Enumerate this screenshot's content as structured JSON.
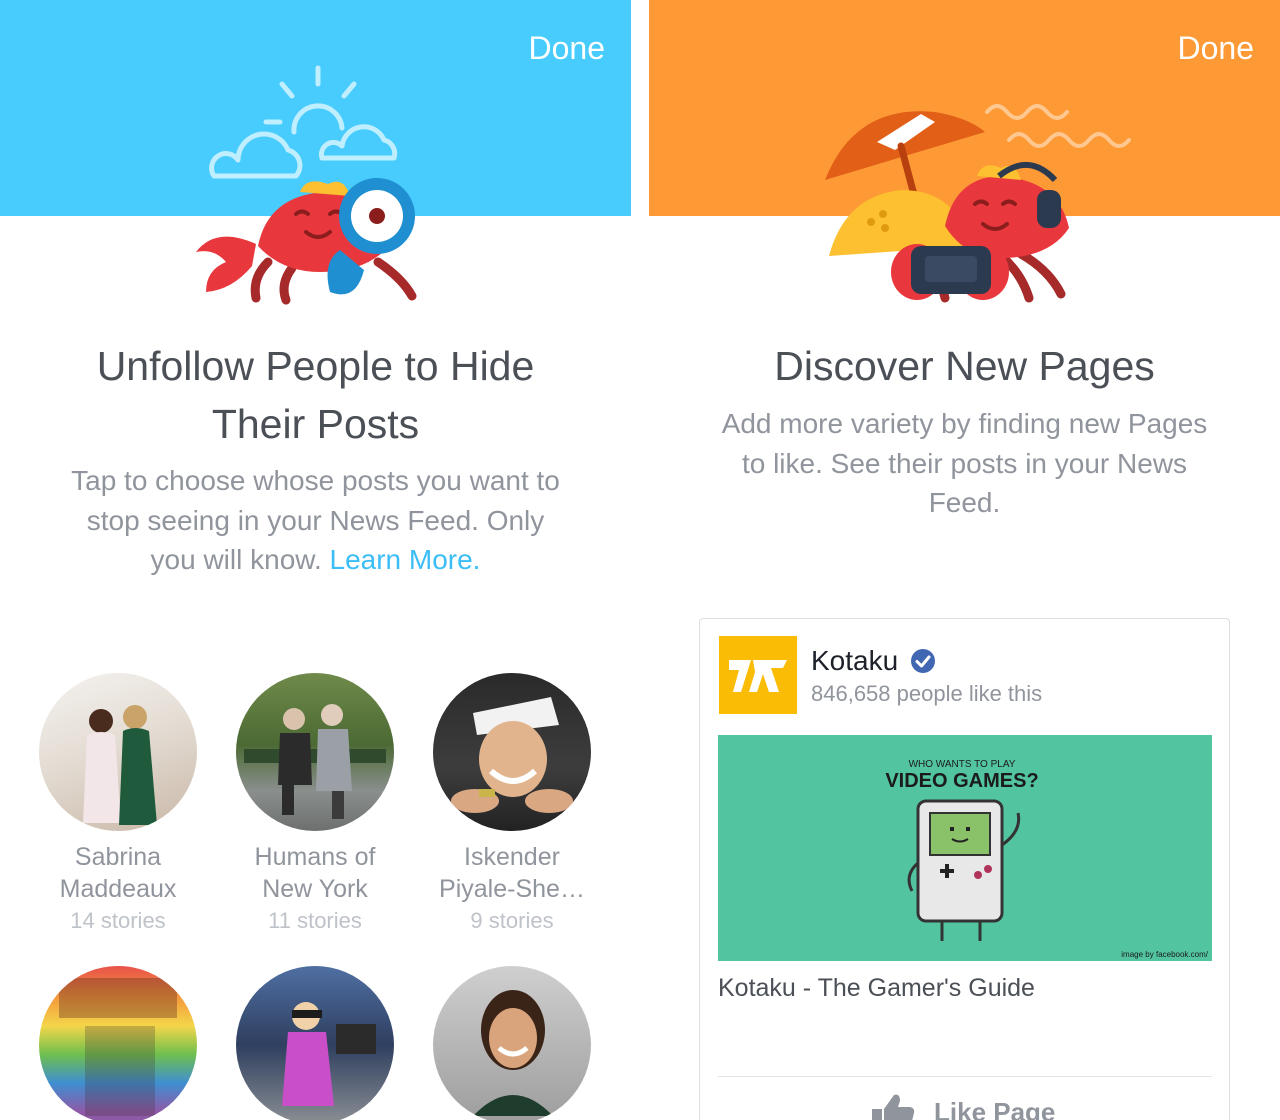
{
  "left_panel": {
    "banner_color": "#47ccfd",
    "done_label": "Done",
    "title_line1": "Unfollow People to Hide",
    "title_line2": "Their Posts",
    "desc_line1": "Tap to choose whose posts you want to",
    "desc_line2": "stop seeing in your News Feed. Only",
    "desc_line3_prefix": "you will know.",
    "learn_more": "Learn More.",
    "illustration": [
      "sun-icon",
      "cloud-icon",
      "crab-with-magnifier-icon"
    ],
    "people": [
      {
        "name_line1": "Sabrina",
        "name_line2": "Maddeaux",
        "stories": "14 stories"
      },
      {
        "name_line1": "Humans of",
        "name_line2": "New York",
        "stories": "11 stories"
      },
      {
        "name_line1": "Iskender",
        "name_line2": "Piyale-She…",
        "stories": "9 stories"
      }
    ]
  },
  "right_panel": {
    "banner_color": "#fe9a36",
    "done_label": "Done",
    "title": "Discover New Pages",
    "desc_line1": "Add more variety by finding new Pages",
    "desc_line2": "to like. See their posts in your News",
    "desc_line3": "Feed.",
    "illustration": [
      "beach-umbrella-icon",
      "waves-icon",
      "crab-with-headphones-icon"
    ],
    "card": {
      "page_name": "Kotaku",
      "verified_icon": "verified-badge-icon",
      "likes": "846,658 people like this",
      "cover_small": "WHO WANTS TO PLAY",
      "cover_big": "VIDEO GAMES?",
      "cover_credit": "image by facebook.com/",
      "caption": "Kotaku - The Gamer's Guide",
      "like_label": "Like Page",
      "like_icon": "thumbs-up-icon"
    }
  }
}
